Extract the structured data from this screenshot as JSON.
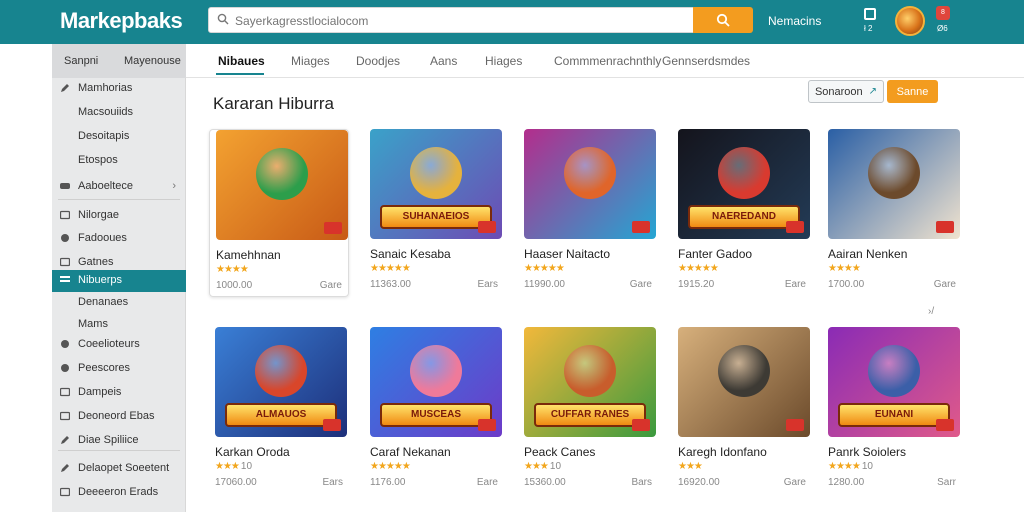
{
  "app": {
    "logo": "Markepbaks",
    "search_placeholder": "Sayerkagresstlocialocom",
    "top_link": "Nemacins",
    "grid_label": "ł 2",
    "notif_count": "8",
    "notif_label": "Ø6"
  },
  "sidebar": {
    "header_left": "Sanpni",
    "header_right": "Mayenouse",
    "items": [
      {
        "label": "Mamhorias",
        "icon": "pencil-icon",
        "group": 1
      },
      {
        "label": "Macsouiids",
        "icon": "",
        "group": 1
      },
      {
        "label": "Desoitapis",
        "icon": "",
        "group": 1
      },
      {
        "label": "Etospos",
        "icon": "",
        "group": 1
      },
      {
        "label": "Aaboeltece",
        "icon": "gamepad-icon",
        "group": 1,
        "chevron": "›"
      },
      {
        "label": "Nilorgae",
        "icon": "image-icon",
        "group": 2
      },
      {
        "label": "Fadooues",
        "icon": "cloud-icon",
        "group": 2
      },
      {
        "label": "Gatnes",
        "icon": "screen-icon",
        "group": 2
      },
      {
        "label": "Nibuerps",
        "icon": "list-icon",
        "group": 2,
        "active": true
      },
      {
        "label": "Denanaes",
        "icon": "",
        "group": 2
      },
      {
        "label": "Mams",
        "icon": "",
        "group": 2
      },
      {
        "label": "Coeelioteurs",
        "icon": "circle-icon",
        "group": 2
      },
      {
        "label": "Peescores",
        "icon": "circle-icon",
        "group": 2
      },
      {
        "label": "Dampeis",
        "icon": "image-icon",
        "group": 2
      },
      {
        "label": "Deoneord Ebas",
        "icon": "image-icon",
        "group": 2
      },
      {
        "label": "Diae Spiliice",
        "icon": "pencil-icon",
        "group": 2
      },
      {
        "label": "Delaopet Soeetent",
        "icon": "pencil-icon",
        "group": 3
      },
      {
        "label": "Deeeeron Erads",
        "icon": "screen-icon",
        "group": 3
      }
    ]
  },
  "tabs": [
    {
      "label": "Nibaues",
      "active": true
    },
    {
      "label": "Miages"
    },
    {
      "label": "Doodjes"
    },
    {
      "label": "Aans"
    },
    {
      "label": "Hiages"
    },
    {
      "label": "Commmenrachnthly"
    },
    {
      "label": "Gennserdsmdes"
    }
  ],
  "section": {
    "title": "Kararan Hiburra",
    "filter_label": "Sonaroon",
    "save_label": "Sanne",
    "more_label": "›/"
  },
  "cards": [
    {
      "title": "Kamehhnan",
      "rating": "★★★★",
      "rnum": "",
      "count": "1000.00",
      "tag": "Gare",
      "banner": "",
      "colors": [
        "#f3a231",
        "#c85a16"
      ],
      "char": "#2c9e4b",
      "highlighted": true
    },
    {
      "title": "Sanaic Kesaba",
      "rating": "★★★★★",
      "rnum": "",
      "count": "11363.00",
      "tag": "Ears",
      "banner": "SUHANAEIOS",
      "colors": [
        "#3aa2c9",
        "#6d4bb4"
      ],
      "char": "#e5b23d"
    },
    {
      "title": "Haaser Naitacto",
      "rating": "★★★★★",
      "rnum": "",
      "count": "11990.00",
      "tag": "Gare",
      "banner": "",
      "colors": [
        "#b32d8c",
        "#24a6d3"
      ],
      "char": "#e0652a"
    },
    {
      "title": "Fanter Gadoo",
      "rating": "★★★★★",
      "rnum": "",
      "count": "1915.20",
      "tag": "Eare",
      "banner": "NAEREDAND",
      "colors": [
        "#14141c",
        "#233b56"
      ],
      "char": "#d93a2f"
    },
    {
      "title": "Aairan Nenken",
      "rating": "★★★★",
      "rnum": "",
      "count": "1700.00",
      "tag": "Gare",
      "banner": "",
      "colors": [
        "#2a5fa5",
        "#f0e3cf"
      ],
      "char": "#6c4a2c"
    },
    {
      "title": "Karkan Oroda",
      "rating": "★★★",
      "rnum": "10",
      "count": "17060.00",
      "tag": "Ears",
      "banner": "ALMAUOS",
      "colors": [
        "#3a7fd6",
        "#1d2f7a"
      ],
      "char": "#d9462a"
    },
    {
      "title": "Caraf Nekanan",
      "rating": "★★★★★",
      "rnum": "",
      "count": "1176.00",
      "tag": "Eare",
      "banner": "MUSCEAS",
      "colors": [
        "#2e7fe3",
        "#6d3bc8"
      ],
      "char": "#ef7a9a"
    },
    {
      "title": "Peack Canes",
      "rating": "★★★",
      "rnum": "10",
      "count": "15360.00",
      "tag": "Bars",
      "banner": "CUFFAR RANES",
      "colors": [
        "#f2b83b",
        "#3a9a3e"
      ],
      "char": "#c85d2c"
    },
    {
      "title": "Karegh Idonfano",
      "rating": "★★★",
      "rnum": "",
      "count": "16920.00",
      "tag": "Gare",
      "banner": "",
      "colors": [
        "#d7b07c",
        "#6b4a2b"
      ],
      "char": "#3d3a34"
    },
    {
      "title": "Panrk Soiolers",
      "rating": "★★★★",
      "rnum": "10",
      "count": "1280.00",
      "tag": "Sarr",
      "banner": "EUNANI",
      "colors": [
        "#8a2bb5",
        "#e05a8a"
      ],
      "char": "#3b5fa8"
    }
  ]
}
